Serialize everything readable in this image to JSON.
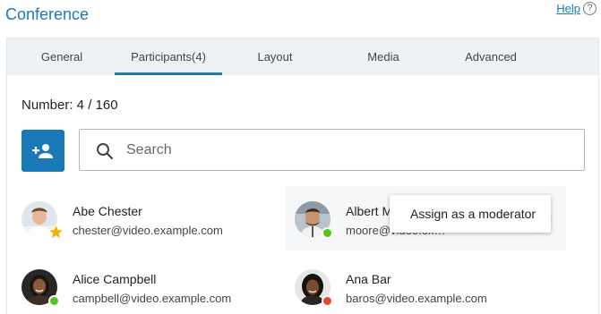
{
  "header": {
    "title": "Conference",
    "help_label": "Help",
    "help_icon": "?"
  },
  "tabs": [
    {
      "label": "General"
    },
    {
      "label": "Participants(4)",
      "active": true
    },
    {
      "label": "Layout"
    },
    {
      "label": "Media"
    },
    {
      "label": "Advanced"
    }
  ],
  "participants_panel": {
    "number_text": "Number: 4 / 160",
    "add_button_icon": "person-add-icon",
    "search_placeholder": "Search",
    "participants": [
      {
        "name": "Abe Chester",
        "email": "chester@video.example.com",
        "badge": "moderator-star"
      },
      {
        "name": "Albert Moore",
        "email": "moore@video.ex…",
        "status": "online",
        "status_color": "#52c41a"
      },
      {
        "name": "Alice Campbell",
        "email": "campbell@video.example.com",
        "status": "online",
        "status_color": "#52c41a"
      },
      {
        "name": "Ana Bar",
        "email": "baros@video.example.com",
        "status": "busy",
        "status_color": "#e64a2e"
      }
    ],
    "context_menu": {
      "items": [
        {
          "label": "Assign as a moderator"
        }
      ]
    }
  },
  "colors": {
    "accent": "#1a7ab7",
    "tab_bar": "#eef2f5",
    "star": "#f5b400"
  }
}
